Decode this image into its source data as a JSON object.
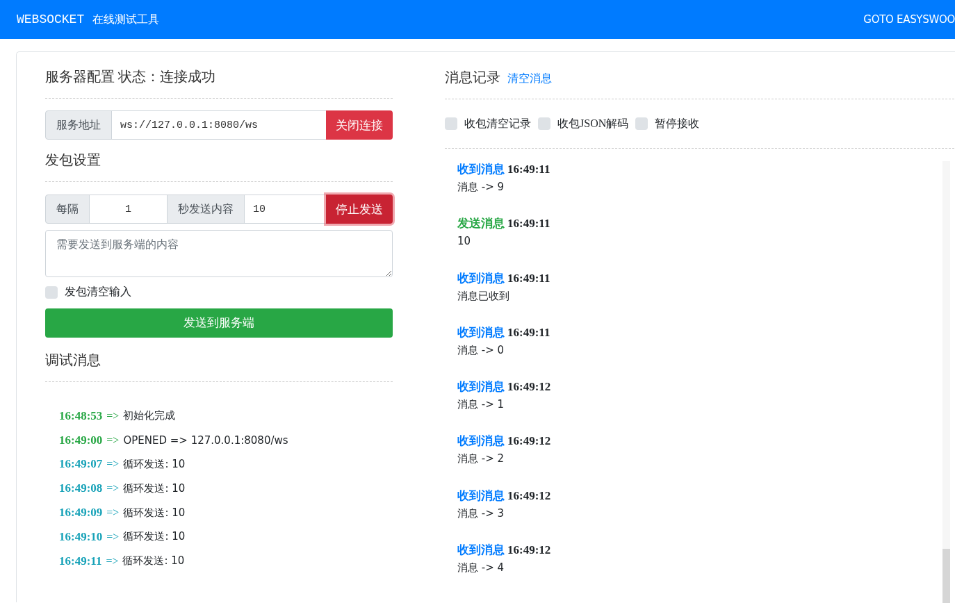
{
  "navbar": {
    "brand": "WEBSOCKET",
    "subtitle": "在线测试工具",
    "link": "GOTO EASYSWOO"
  },
  "server": {
    "title": "服务器配置",
    "status": "状态：连接成功",
    "address_label": "服务地址",
    "address": "ws://127.0.0.1:8080/ws",
    "button": "关闭连接"
  },
  "send": {
    "title": "发包设置",
    "every_label": "每隔",
    "interval": "1",
    "content_label": "秒发送内容",
    "content": "10",
    "button": "停止发送",
    "button_focused": true,
    "textarea_placeholder": "需要发送到服务端的内容",
    "clear_option": {
      "label": "发包清空输入",
      "checked": false
    },
    "send_button": "发送到服务端"
  },
  "debug": {
    "title": "调试消息",
    "entries": [
      {
        "kind": "success",
        "time": "16:48:53",
        "arrow": "=>",
        "text": "初始化完成"
      },
      {
        "kind": "success",
        "time": "16:49:00",
        "arrow": "=>",
        "text": "OPENED => 127.0.0.1:8080/ws"
      },
      {
        "kind": "info",
        "time": "16:49:07",
        "arrow": "=>",
        "text": "循环发送: 10"
      },
      {
        "kind": "info",
        "time": "16:49:08",
        "arrow": "=>",
        "text": "循环发送: 10"
      },
      {
        "kind": "info",
        "time": "16:49:09",
        "arrow": "=>",
        "text": "循环发送: 10"
      },
      {
        "kind": "info",
        "time": "16:49:10",
        "arrow": "=>",
        "text": "循环发送: 10"
      },
      {
        "kind": "info",
        "time": "16:49:11",
        "arrow": "=>",
        "text": "循环发送: 10"
      }
    ]
  },
  "messages": {
    "title": "消息记录",
    "clear_link": "清空消息",
    "options": [
      {
        "label": "收包清空记录",
        "checked": false
      },
      {
        "label": "收包JSON解码",
        "checked": false
      },
      {
        "label": "暂停接收",
        "checked": false
      }
    ],
    "items": [
      {
        "kind": "received",
        "label": "收到消息",
        "time": "16:49:11",
        "body": "消息 -> 9"
      },
      {
        "kind": "sent",
        "label": "发送消息",
        "time": "16:49:11",
        "body": "10"
      },
      {
        "kind": "received",
        "label": "收到消息",
        "time": "16:49:11",
        "body": "消息已收到"
      },
      {
        "kind": "received",
        "label": "收到消息",
        "time": "16:49:11",
        "body": "消息 -> 0"
      },
      {
        "kind": "received",
        "label": "收到消息",
        "time": "16:49:12",
        "body": "消息 -> 1"
      },
      {
        "kind": "received",
        "label": "收到消息",
        "time": "16:49:12",
        "body": "消息 -> 2"
      },
      {
        "kind": "received",
        "label": "收到消息",
        "time": "16:49:12",
        "body": "消息 -> 3"
      },
      {
        "kind": "received",
        "label": "收到消息",
        "time": "16:49:12",
        "body": "消息 -> 4"
      }
    ]
  }
}
